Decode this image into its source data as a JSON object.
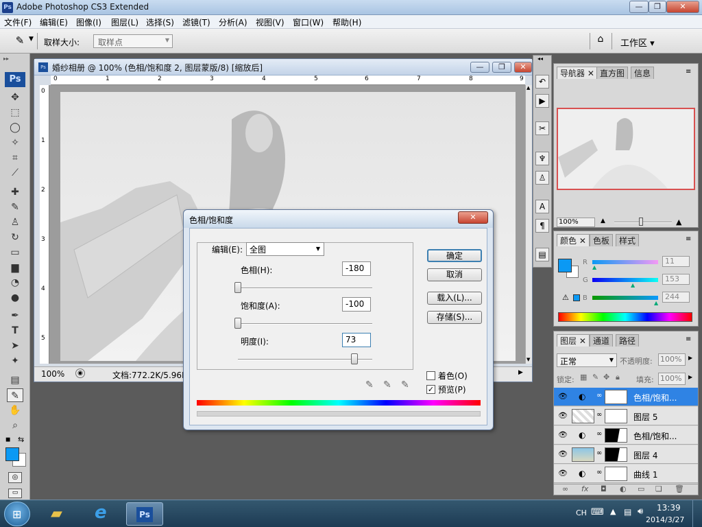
{
  "window": {
    "title": "Adobe Photoshop CS3 Extended",
    "app_badge": "Ps",
    "minimize": "—",
    "restore": "❐",
    "close": "✕"
  },
  "menu": {
    "items": [
      "文件(F)",
      "编辑(E)",
      "图像(I)",
      "图层(L)",
      "选择(S)",
      "滤镜(T)",
      "分析(A)",
      "视图(V)",
      "窗口(W)",
      "帮助(H)"
    ]
  },
  "options": {
    "sample_size_label": "取样大小:",
    "sample_size_value": "取样点",
    "workspace": "工作区 ▾"
  },
  "toolbox": {
    "badge": "Ps"
  },
  "document": {
    "title": "婚纱相册 @ 100% (色相/饱和度 2, 图层蒙版/8) [缩放后]",
    "ruler_top": [
      "0",
      "1",
      "2",
      "3",
      "4",
      "5",
      "6",
      "7",
      "8",
      "9"
    ],
    "ruler_left": [
      "0",
      "1",
      "2",
      "3",
      "4",
      "5"
    ],
    "zoom": "100%",
    "doc_size": "文档:772.2K/5.96M"
  },
  "navigator": {
    "tabs": [
      "导航器",
      "直方图",
      "信息"
    ],
    "zoom": "100%"
  },
  "color_panel": {
    "tabs": [
      "颜色",
      "色板",
      "样式"
    ],
    "r_label": "R",
    "g_label": "G",
    "b_label": "B",
    "r_value": "11",
    "g_value": "153",
    "b_value": "244",
    "swatch_color": "#0b99f4"
  },
  "layers_panel": {
    "tabs": [
      "图层",
      "通道",
      "路径"
    ],
    "blend_mode": "正常",
    "opacity_label": "不透明度:",
    "opacity_value": "100%",
    "lock_label": "锁定:",
    "fill_label": "填充:",
    "fill_value": "100%",
    "layers": [
      {
        "name": "色相/饱和..."
      },
      {
        "name": "图层 5"
      },
      {
        "name": "色相/饱和..."
      },
      {
        "name": "图层 4"
      },
      {
        "name": "曲线 1"
      }
    ]
  },
  "dialog": {
    "title": "色相/饱和度",
    "edit_label": "编辑(E):",
    "edit_value": "全图",
    "hue_label": "色相(H):",
    "hue_value": "-180",
    "hue_level": -180,
    "saturation_label": "饱和度(A):",
    "saturation_value": "-100",
    "saturation_level": -100,
    "lightness_label": "明度(I):",
    "lightness_value": "73",
    "lightness_level": 73,
    "ok": "确定",
    "cancel": "取消",
    "load": "载入(L)...",
    "save": "存储(S)...",
    "colorize": "着色(O)",
    "preview": "预览(P)",
    "preview_checked": true,
    "colorize_checked": false
  },
  "taskbar": {
    "lang": "CH",
    "time": "13:39",
    "date": "2014/3/27"
  }
}
